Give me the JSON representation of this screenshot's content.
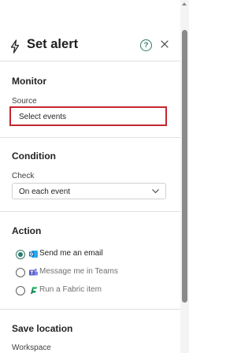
{
  "panel": {
    "title": "Set alert",
    "help_glyph": "?"
  },
  "monitor": {
    "heading": "Monitor",
    "source_label": "Source",
    "source_value": "Select events"
  },
  "condition": {
    "heading": "Condition",
    "check_label": "Check",
    "check_value": "On each event"
  },
  "action": {
    "heading": "Action",
    "options": [
      {
        "label": "Send me an email",
        "icon": "outlook-icon",
        "selected": true
      },
      {
        "label": "Message me in Teams",
        "icon": "teams-icon",
        "selected": false
      },
      {
        "label": "Run a Fabric item",
        "icon": "fabric-icon",
        "selected": false
      }
    ]
  },
  "save_location": {
    "heading": "Save location",
    "workspace_label": "Workspace"
  },
  "colors": {
    "accent": "#2f7a6a",
    "highlight_border": "#c4262e",
    "outlook_blue": "#0f6cbd",
    "teams_purple": "#5b5fc7",
    "fabric_green": "#1a8a5a"
  }
}
